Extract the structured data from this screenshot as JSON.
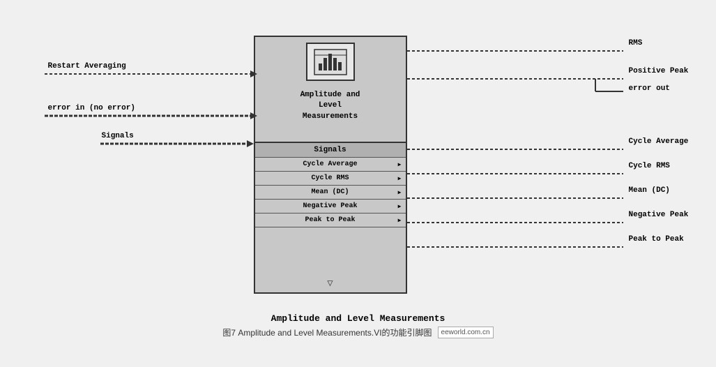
{
  "diagram": {
    "block": {
      "title_line1": "Amplitude and",
      "title_line2": "Level",
      "title_line3": "Measurements"
    },
    "inputs": [
      {
        "label": "Restart Averaging",
        "type": "dashed",
        "row": 0
      },
      {
        "label": "error in (no error)",
        "type": "solid",
        "row": 1
      },
      {
        "label": "Signals",
        "type": "solid",
        "row": 2
      }
    ],
    "outputs_top": [
      {
        "label": "RMS",
        "row": 0
      },
      {
        "label": "Positive Peak",
        "row": 1
      },
      {
        "label": "error out",
        "row": 2
      }
    ],
    "outputs_table": [
      {
        "label": "Cycle Average"
      },
      {
        "label": "Cycle RMS"
      },
      {
        "label": "Mean (DC)"
      },
      {
        "label": "Negative Peak"
      },
      {
        "label": "Peak to Peak"
      }
    ],
    "signals_label": "Signals"
  },
  "caption": {
    "title": "Amplitude and Level Measurements",
    "subtitle": "图7  Amplitude and Level Measurements.VI的功能引脚图",
    "watermark": "eeworld.com.cn"
  }
}
